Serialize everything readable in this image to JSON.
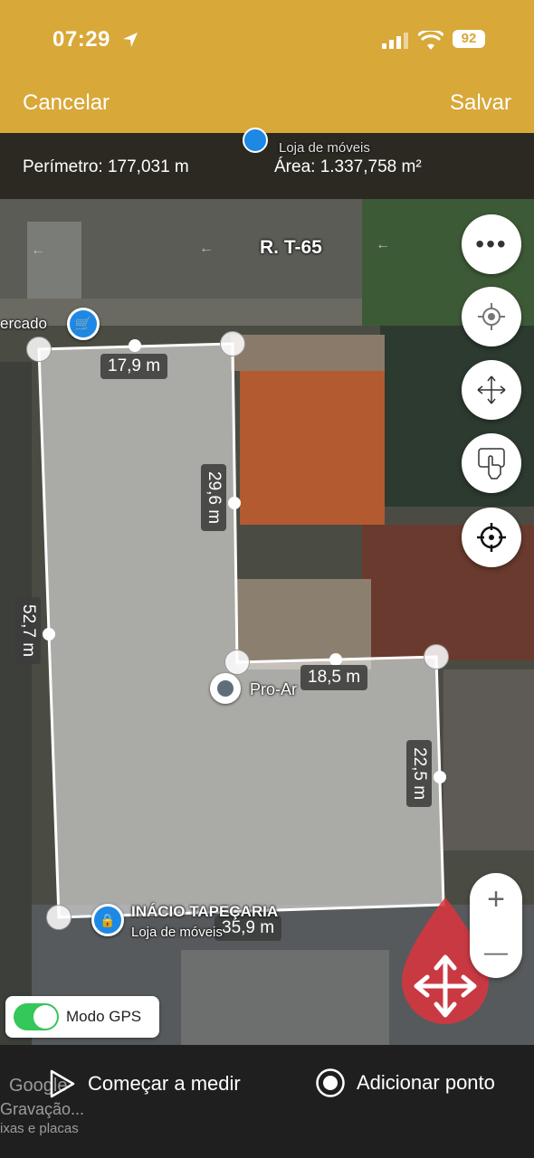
{
  "status_bar": {
    "time": "07:29",
    "battery": "92"
  },
  "header": {
    "cancel_label": "Cancelar",
    "save_label": "Salvar"
  },
  "measurements": {
    "perimeter": "Perímetro: 177,031 m",
    "area": "Área: 1.337,758 m²"
  },
  "map": {
    "street_name": "R. T-65",
    "pois": [
      {
        "name": "ercado"
      },
      {
        "name": "Pro-Ar"
      },
      {
        "name": "INÁCIO TAPEÇARIA",
        "category": "Loja de móveis"
      },
      {
        "name": "Loja de móveis"
      }
    ],
    "edge_labels": [
      "17,9 m",
      "29,6 m",
      "52,7 m",
      "18,5 m",
      "22,5 m",
      "35,9 m"
    ]
  },
  "controls": {
    "gps_mode_label": "Modo GPS",
    "gps_mode_on": true,
    "zoom_in": "+",
    "zoom_out": "—"
  },
  "bottom": {
    "start_label": "Começar a medir",
    "add_point_label": "Adicionar ponto",
    "footer": [
      "Google",
      "Gravação...",
      "ixas e placas"
    ]
  },
  "colors": {
    "header": "#d8a838",
    "polygon_fill": "rgba(240,240,240,0.55)",
    "gps_toggle": "#34c759"
  }
}
